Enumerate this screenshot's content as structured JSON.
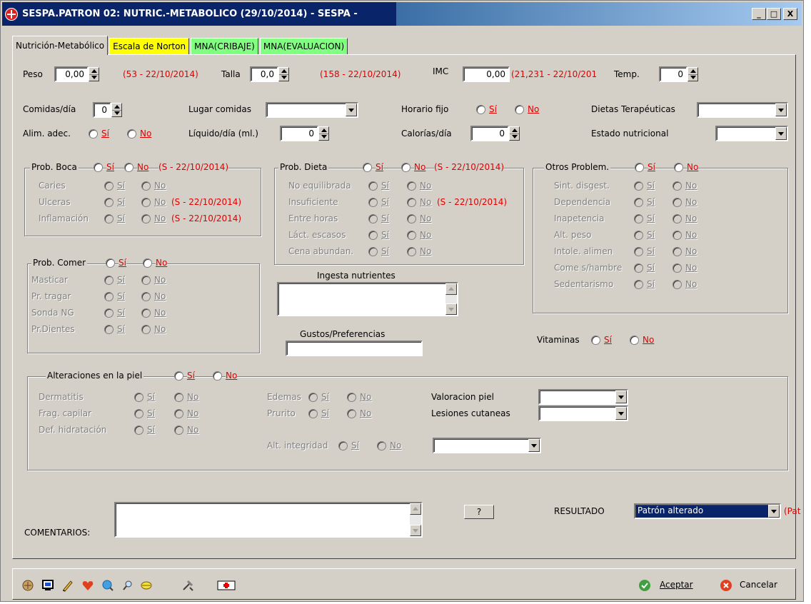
{
  "window": {
    "title": "SESPA.PATRON 02: NUTRIC.-METABOLICO (29/10/2014) - SESPA -",
    "min": "_",
    "max": "□",
    "close": "X"
  },
  "tabs": [
    {
      "label": "Nutrición-Metabólico"
    },
    {
      "label": "Escala de Norton"
    },
    {
      "label": "MNA(CRIBAJE)"
    },
    {
      "label": "MNA(EVALUACION)"
    }
  ],
  "measures": {
    "peso_label": "Peso",
    "peso_value": "0,00",
    "peso_ref": "(53 - 22/10/2014)",
    "talla_label": "Talla",
    "talla_value": "0,0",
    "talla_ref": "(158 - 22/10/2014)",
    "imc_label": "IMC",
    "imc_value": "0,00",
    "imc_ref": "(21,231 - 22/10/201",
    "temp_label": "Temp.",
    "temp_value": "0"
  },
  "row2": {
    "comidas_label": "Comidas/día",
    "comidas_value": "0",
    "lugar_label": "Lugar comidas",
    "horario_label": "Horario fijo",
    "dietas_label": "Dietas Terapéuticas"
  },
  "row3": {
    "alim_label": "Alim. adec.",
    "liquido_label": "Líquido/día (ml.)",
    "liquido_value": "0",
    "calorias_label": "Calorías/día",
    "calorias_value": "0",
    "estado_label": "Estado nutricional"
  },
  "yes": "Sí",
  "no": "No",
  "boca": {
    "title": "Prob. Boca",
    "ref": "(S - 22/10/2014)",
    "items": [
      {
        "label": "Caries",
        "ref": ""
      },
      {
        "label": "Ulceras",
        "ref": "(S - 22/10/2014)"
      },
      {
        "label": "Inflamación",
        "ref": "(S - 22/10/2014)"
      }
    ]
  },
  "dieta": {
    "title": "Prob. Dieta",
    "ref": "(S - 22/10/2014)",
    "items": [
      {
        "label": "No equilibrada",
        "ref": ""
      },
      {
        "label": "Insuficiente",
        "ref": "(S - 22/10/2014)"
      },
      {
        "label": "Entre horas",
        "ref": ""
      },
      {
        "label": "Láct. escasos",
        "ref": ""
      },
      {
        "label": "Cena abundan.",
        "ref": ""
      }
    ]
  },
  "otros": {
    "title": "Otros Problem.",
    "items": [
      {
        "label": "Sint. disgest."
      },
      {
        "label": "Dependencia"
      },
      {
        "label": "Inapetencia"
      },
      {
        "label": "Alt. peso"
      },
      {
        "label": "Intole. alimen"
      },
      {
        "label": "Come s/hambre"
      },
      {
        "label": "Sedentarismo"
      }
    ]
  },
  "comer": {
    "title": "Prob. Comer",
    "items": [
      {
        "label": "Masticar"
      },
      {
        "label": "Pr. tragar"
      },
      {
        "label": "Sonda NG"
      },
      {
        "label": "Pr.Dientes"
      }
    ]
  },
  "ingesta_label": "Ingesta nutrientes",
  "gustos_label": "Gustos/Preferencias",
  "vitaminas_label": "Vitaminas",
  "piel": {
    "title": "Alteraciones en la piel",
    "col1": [
      {
        "label": "Dermatitis"
      },
      {
        "label": "Frag. capilar"
      },
      {
        "label": "Def. hidratación"
      }
    ],
    "edemas_label": "Edemas",
    "prurito_label": "Prurito",
    "integridad_label": "Alt. integridad",
    "valoracion_label": "Valoracion piel",
    "lesiones_label": "Lesiones cutaneas"
  },
  "comentarios_label": "COMENTARIOS:",
  "help_btn": "?",
  "resultado_label": "RESULTADO",
  "resultado_value": "Patrón alterado",
  "resultado_ref": "(Pat",
  "aceptar": "Aceptar",
  "cancelar": "Cancelar"
}
